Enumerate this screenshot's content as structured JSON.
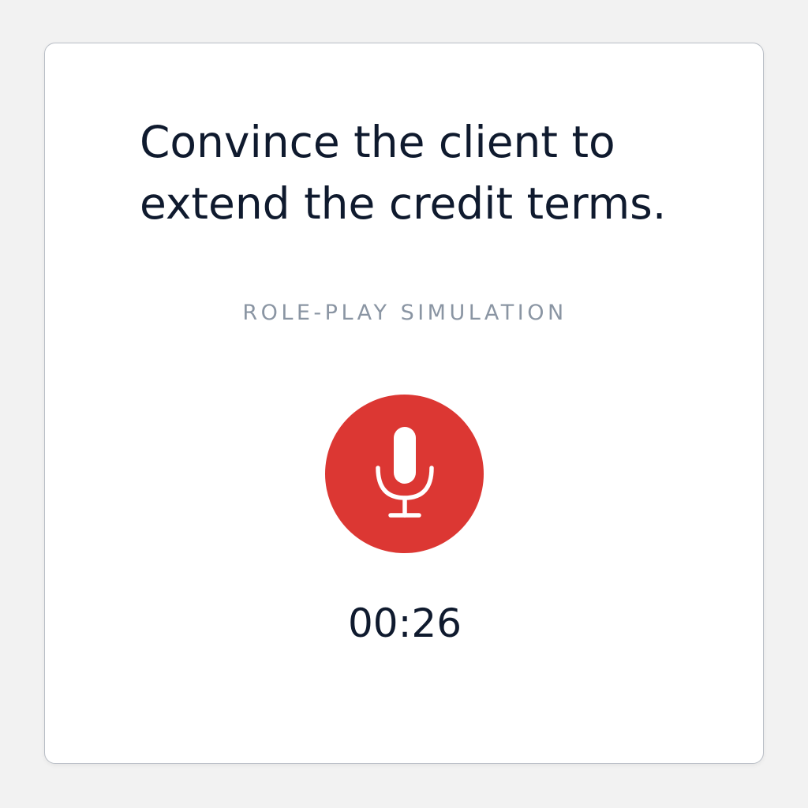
{
  "prompt": {
    "line1": "Convince the client to",
    "line2": "extend the credit terms."
  },
  "mode_label": "ROLE-PLAY SIMULATION",
  "record_button": {
    "icon": "microphone-icon",
    "color": "#dc3733"
  },
  "timer": "00:26"
}
